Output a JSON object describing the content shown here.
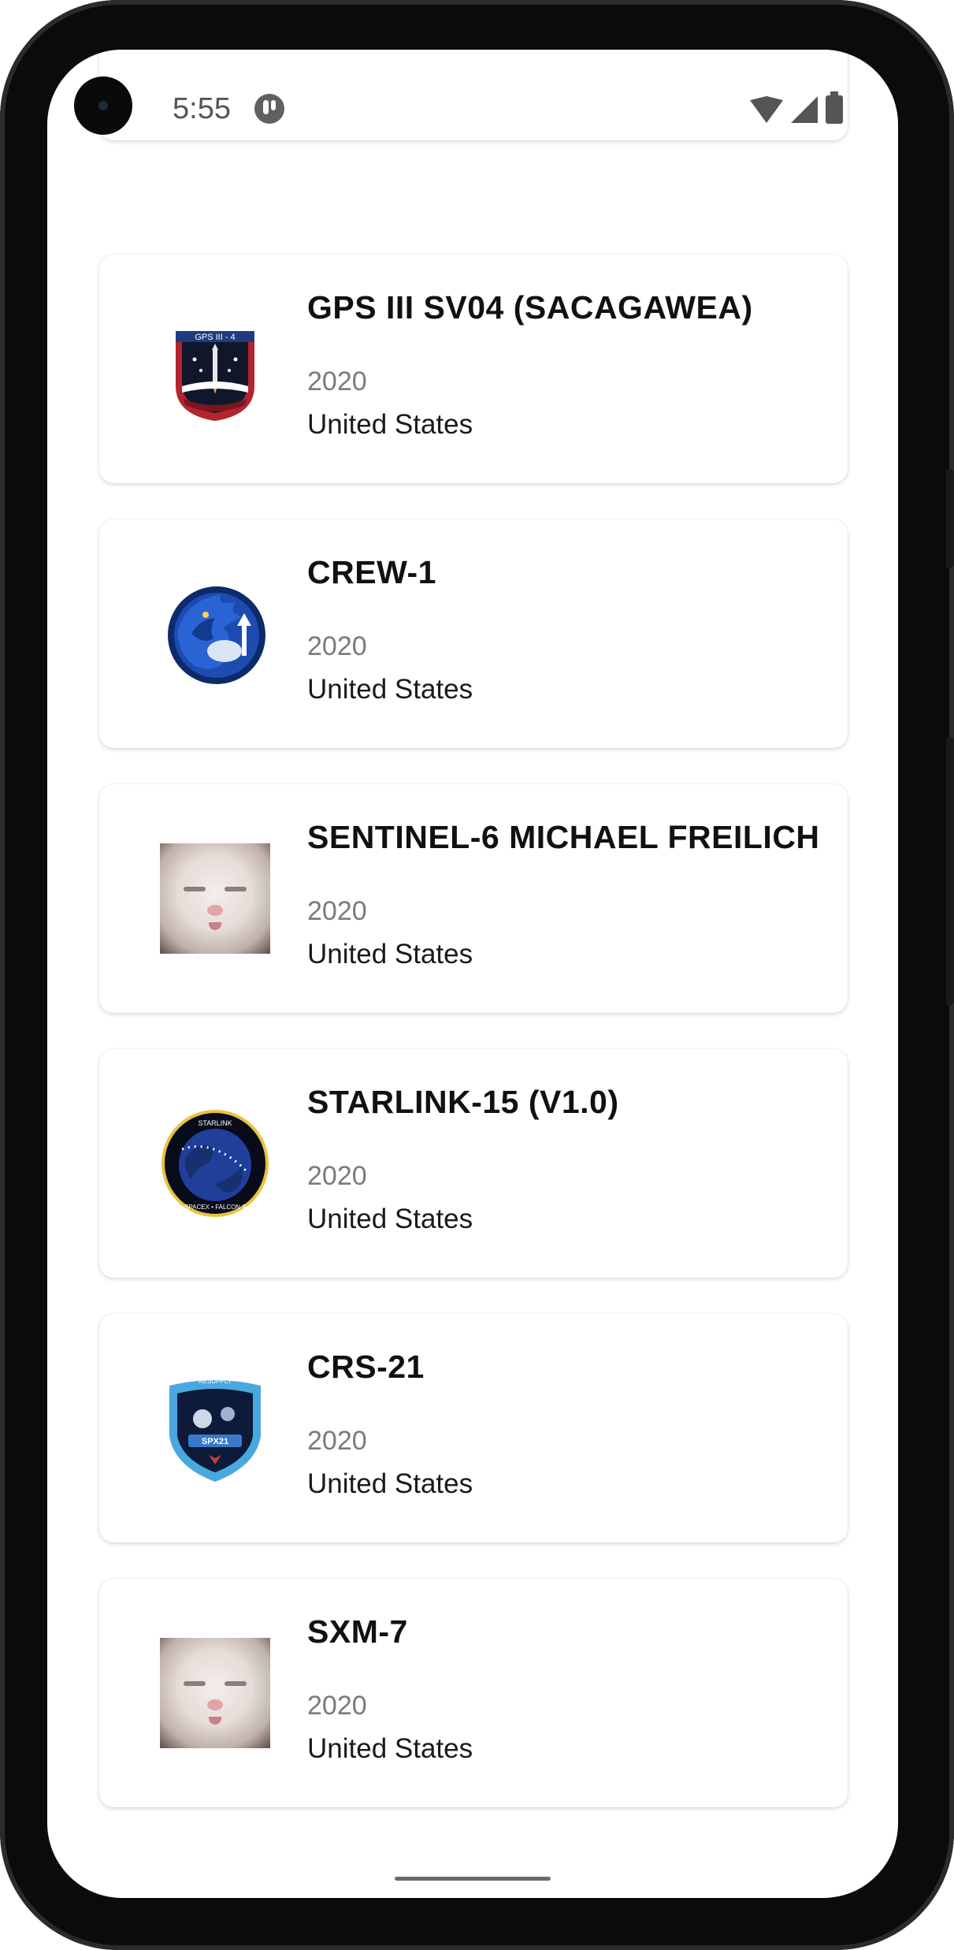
{
  "status_bar": {
    "time": "5:55"
  },
  "launches": [
    {
      "name": "GPS III SV04 (SACAGAWEA)",
      "year": "2020",
      "country": "United States",
      "patch": "gps-iii-sv04-patch"
    },
    {
      "name": "CREW-1",
      "year": "2020",
      "country": "United States",
      "patch": "crew-1-patch"
    },
    {
      "name": "SENTINEL-6 MICHAEL FREILICH",
      "year": "2020",
      "country": "United States",
      "patch": "kitten-placeholder-image"
    },
    {
      "name": "STARLINK-15 (V1.0)",
      "year": "2020",
      "country": "United States",
      "patch": "starlink-patch"
    },
    {
      "name": "CRS-21",
      "year": "2020",
      "country": "United States",
      "patch": "crs-21-patch"
    },
    {
      "name": "SXM-7",
      "year": "2020",
      "country": "United States",
      "patch": "kitten-placeholder-image"
    }
  ],
  "colors": {
    "card_bg": "#ffffff",
    "title": "#111111",
    "year": "#7a7a7a",
    "country": "#1a1a1a"
  }
}
